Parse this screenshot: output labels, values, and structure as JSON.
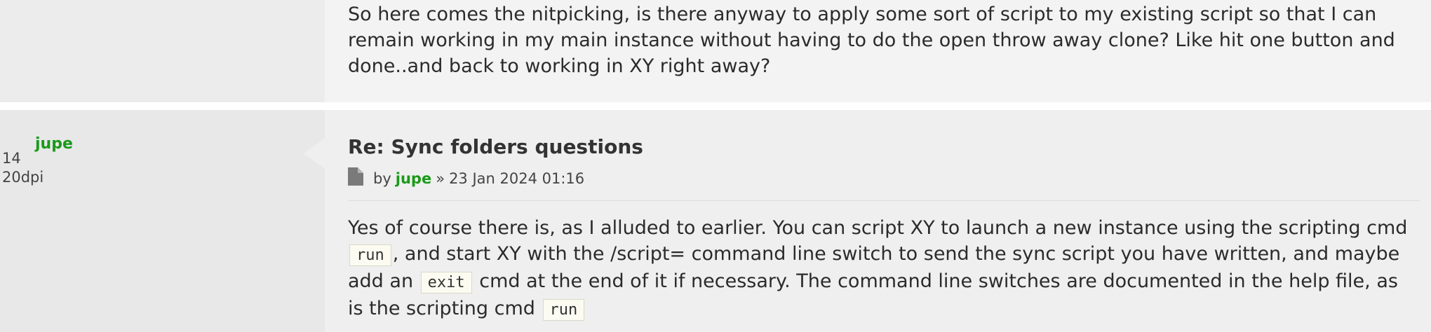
{
  "previous_post": {
    "text": "So here comes the nitpicking, is there anyway to apply some sort of script to my existing script so that I can remain working in my main instance without having to do the open throw away clone? Like hit one button and done..and back to working in XY right away?"
  },
  "reply": {
    "author": "jupe",
    "profile": {
      "line1": "14",
      "line2": "20dpi"
    },
    "title": "Re: Sync folders questions",
    "meta": {
      "by": "by",
      "user": "jupe",
      "separator": "»",
      "datetime": "23 Jan 2024 01:16"
    },
    "body": {
      "p1": "Yes of course there is, as I alluded to earlier. You can script XY to launch a new instance using the scripting cmd",
      "code1": "run",
      "p2": ", and start XY with the /script= command line switch to send the sync script you have written, and maybe add an",
      "code2": "exit",
      "p3": "cmd at the end of it if necessary. The command line switches are documented in the help file, as is the scripting cmd",
      "code3": "run"
    }
  },
  "colors": {
    "username": "#1a9a1a",
    "post_bg": "#efefef",
    "sidebar_bg": "#e8e8e8"
  },
  "icons": {
    "post_icon": "document-icon"
  }
}
